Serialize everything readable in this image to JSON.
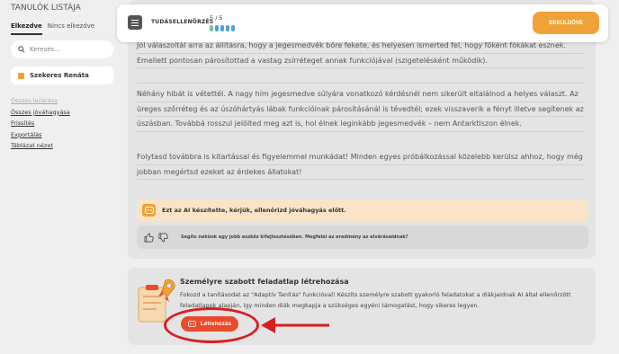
{
  "sidebar": {
    "title": "TANULÓK LISTÁJA",
    "tabs": [
      {
        "label": "Elkezdve",
        "active": true
      },
      {
        "label": "Nincs elkezdve",
        "active": false
      }
    ],
    "search_placeholder": "Keresés...",
    "selected_student": "Szekeres Renáta",
    "links": {
      "inactive": "Összes lezárása",
      "items": [
        "Összes jóváhagyása",
        "Frissítés",
        "Exportálás",
        "Táblázat nézet"
      ]
    }
  },
  "header": {
    "label": "TUDÁSELLENŐRZÉS",
    "score": "5 / 5",
    "progress_answered": 5,
    "submit_label": "BEKÜLDÖVE"
  },
  "feedback": {
    "paragraphs": [
      "Jól válaszoltál arra az állításra, hogy a jegesmedvék bőre fekete, és helyesen ismerted fel, hogy főként fókákat esznek. Emellett pontosan párosítottad a vastag zsírréteget annak funkciójával (szigetelésként működik).",
      "Néhány hibát is vétettél. A nagy hím jegesmedve súlyára vonatkozó kérdésnél nem sikerült eltalálnod a helyes választ. Az üreges szőrréteg és az úszóhártyás lábak funkcióinak párosításánál is tévedtél; ezek visszaverik a fényt illetve segítenek az úszásban. Továbbá rosszul jelölted meg azt is, hol élnek leginkább jegesmedvék – nem Antarktiszon élnek.",
      "Folytasd továbbra is kitartással és figyelemmel munkádat! Minden egyes próbálkozással közelebb kerülsz ahhoz, hogy még jobban megértsd ezeket az érdekes állatokat!"
    ],
    "ai_note": "Ezt az AI készítette, kérjük, ellenőrizd jóváhagyás előtt.",
    "rating_prompt": "Segíts nekünk egy jobb eszköz kifejlesztésében. Megfelel az eredmény az elvárásaidnak?"
  },
  "worksheet": {
    "title": "Személyre szabott feladatlap létrehozása",
    "description": "Fokozd a tanításodat az \"Adaptív Tanítás\" funkcióval! Készíts személyre szabott gyakorló feladatokat a diákjaidnak AI által ellenőrzött feladatlapok alapján, így minden diák megkapja a szükséges egyéni támogatást, hogy sikeres legyen.",
    "button_label": "Létrehozás"
  },
  "colors": {
    "accent_orange": "#f0a238",
    "create_red": "#ea4a2b",
    "annotation_red": "#d81f1f",
    "progress_blue": "#4aa3df",
    "progress_green": "#6cc4a1",
    "ai_note_bg": "#fbe4c6"
  },
  "icons": {
    "header": "document-list-icon",
    "search": "search-icon",
    "ai": "robot-icon",
    "thumbs_up": "thumbs-up-icon",
    "thumbs_down": "thumbs-down-icon",
    "worksheet": "rocket-clipboard-illustration"
  }
}
